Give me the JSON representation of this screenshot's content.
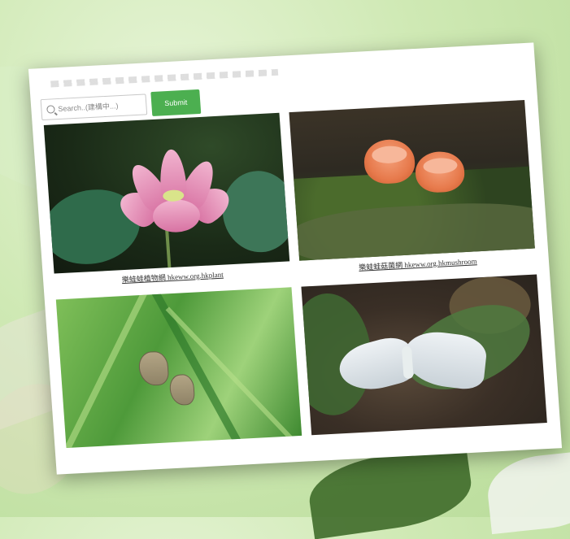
{
  "search": {
    "placeholder": "Search..(建構中...)"
  },
  "submit_label": "Submit",
  "tiles": [
    {
      "image": "lotus flower photo",
      "caption": "樂蛙蛙植物網 hkeww.org.hkplant"
    },
    {
      "image": "orange cup fungi photo",
      "caption": "樂蛙蛙菇菌網 hkeww.org.hkmushroom"
    },
    {
      "image": "butterflies on grass photo",
      "caption": ""
    },
    {
      "image": "white moth on leaf photo",
      "caption": ""
    }
  ],
  "colors": {
    "submit_bg": "#4caf50",
    "background": "#cfe9b4"
  }
}
